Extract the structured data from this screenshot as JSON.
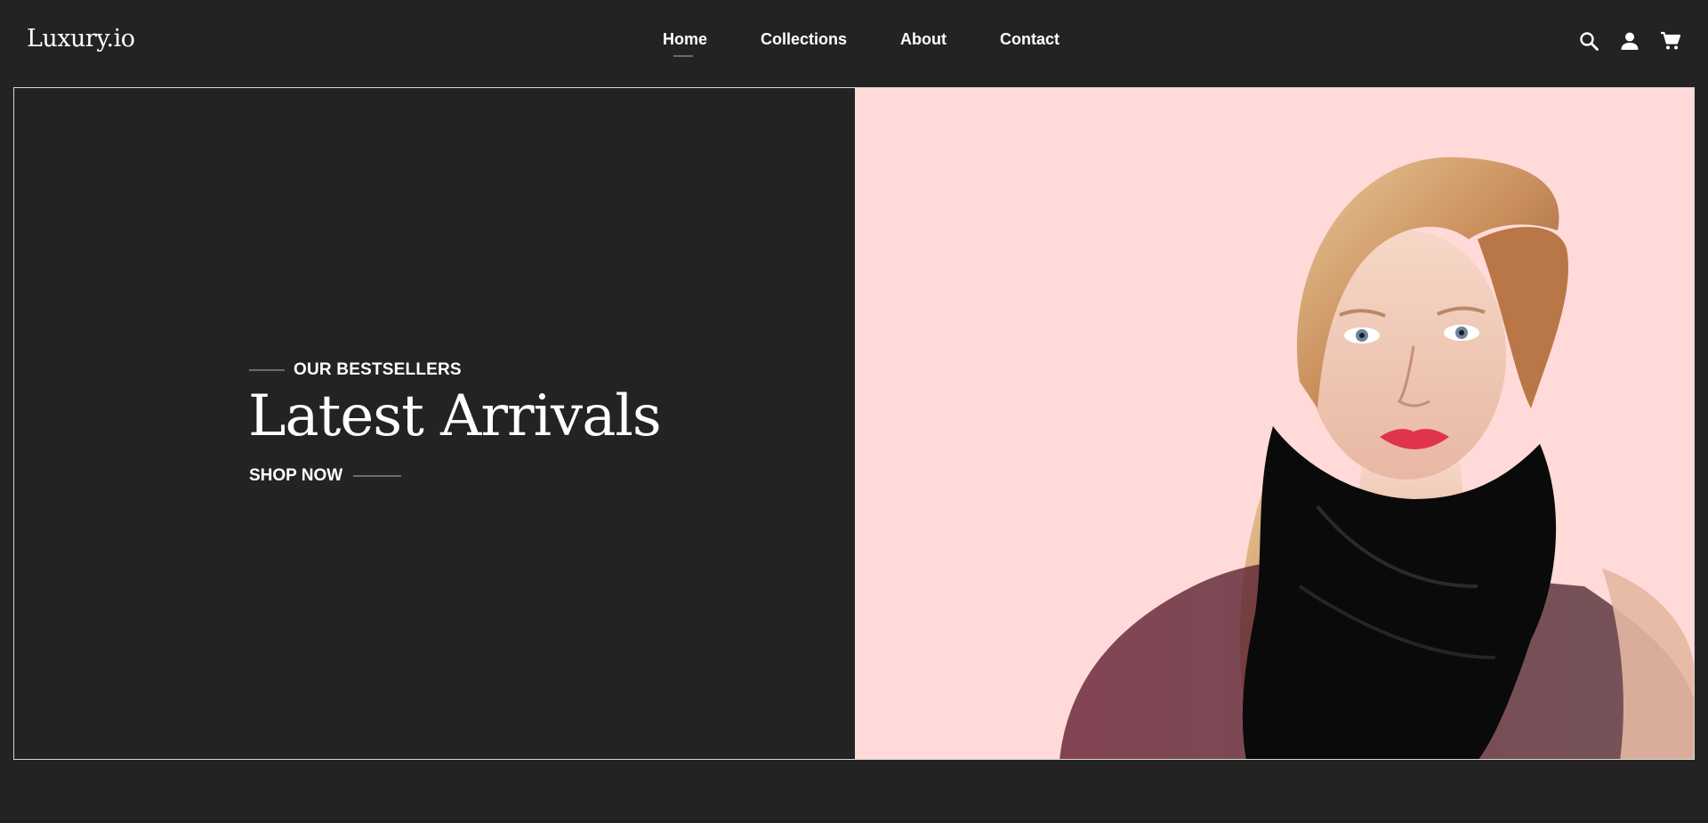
{
  "brand": {
    "logo_text": "Luxury.io"
  },
  "nav": {
    "items": [
      {
        "label": "Home",
        "active": true
      },
      {
        "label": "Collections",
        "active": false
      },
      {
        "label": "About",
        "active": false
      },
      {
        "label": "Contact",
        "active": false
      }
    ]
  },
  "header_icons": [
    "search-icon",
    "user-icon",
    "cart-icon"
  ],
  "hero": {
    "eyebrow": "OUR BESTSELLERS",
    "title": "Latest Arrivals",
    "cta": "SHOP NOW",
    "image_background": "#ffdad8"
  },
  "colors": {
    "background": "#232323",
    "text": "#ffffff",
    "accent_line": "#6c6c6c",
    "hero_image_bg": "#ffdad8"
  }
}
